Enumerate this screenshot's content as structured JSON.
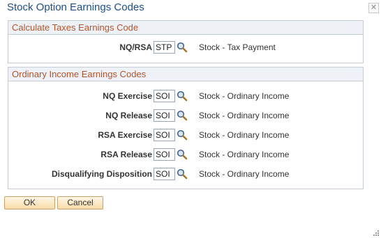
{
  "dialog": {
    "title": "Stock Option Earnings Codes",
    "close_glyph": "✕"
  },
  "taxes_group": {
    "header": "Calculate Taxes Earnings Code",
    "rows": [
      {
        "label": "NQ/RSA",
        "value": "STP",
        "description": "Stock - Tax Payment"
      }
    ]
  },
  "ordinary_group": {
    "header": "Ordinary Income Earnings Codes",
    "rows": [
      {
        "label": "NQ Exercise",
        "value": "SOI",
        "description": "Stock - Ordinary Income"
      },
      {
        "label": "NQ Release",
        "value": "SOI",
        "description": "Stock - Ordinary Income"
      },
      {
        "label": "RSA Exercise",
        "value": "SOI",
        "description": "Stock - Ordinary Income"
      },
      {
        "label": "RSA Release",
        "value": "SOI",
        "description": "Stock - Ordinary Income"
      },
      {
        "label": "Disqualifying Disposition",
        "value": "SOI",
        "description": "Stock - Ordinary Income"
      }
    ]
  },
  "buttons": {
    "ok_label": "OK",
    "cancel_label": "Cancel"
  },
  "icons": {
    "lookup": "magnifier-icon",
    "close": "close-icon",
    "resize": "resize-grip-icon"
  },
  "colors": {
    "title": "#1a4f8a",
    "group_header_text": "#b0562e",
    "group_header_bg": "#eef1f5",
    "button_bg": "#f8dca8"
  }
}
